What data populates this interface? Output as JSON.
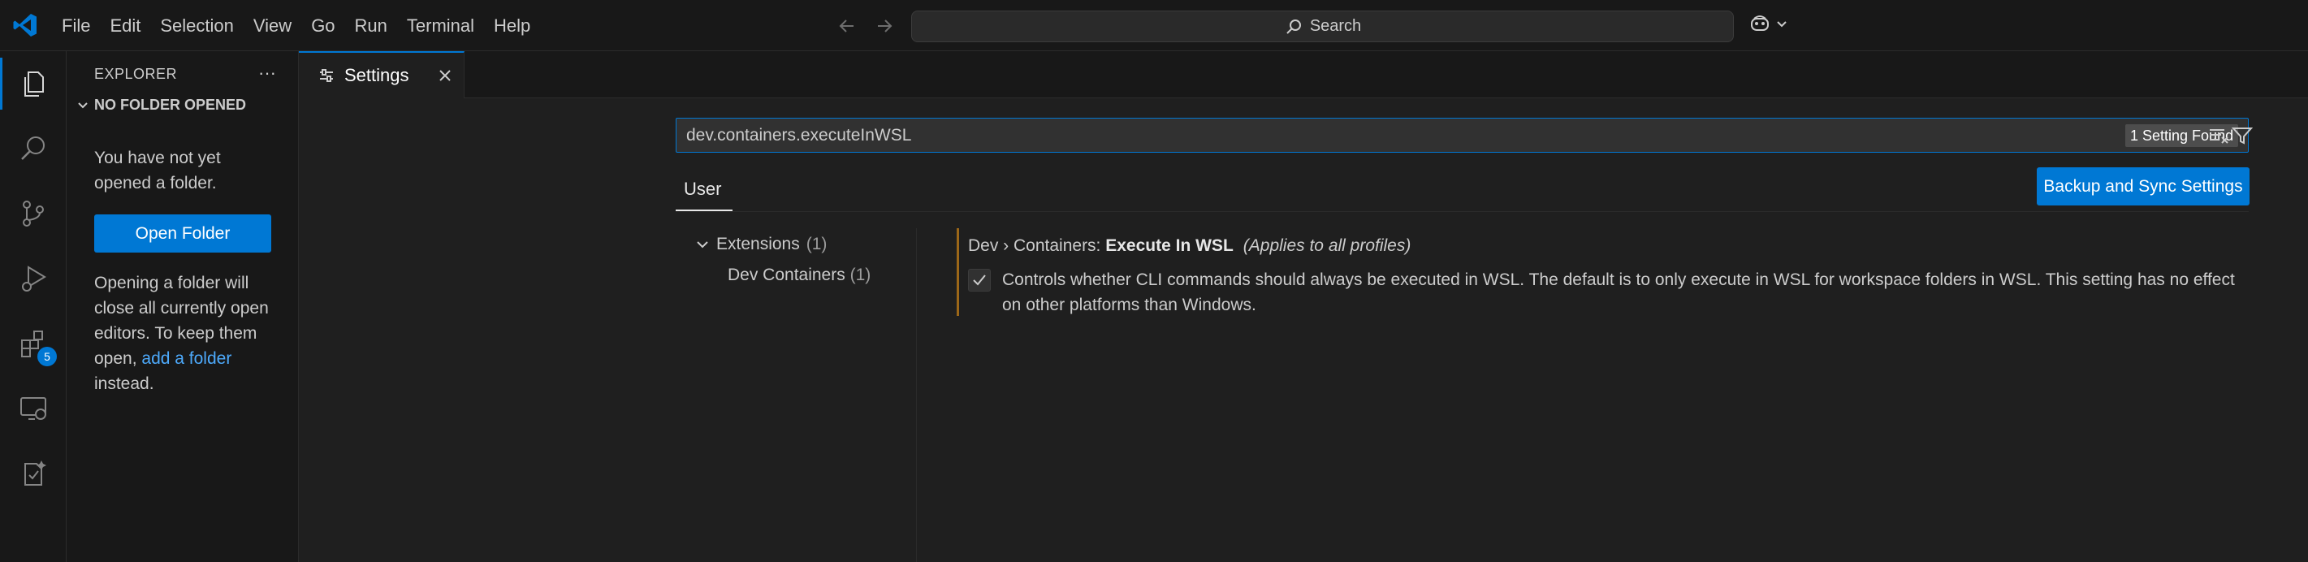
{
  "menu": [
    "File",
    "Edit",
    "Selection",
    "View",
    "Go",
    "Run",
    "Terminal",
    "Help"
  ],
  "command_center": {
    "placeholder": "Search"
  },
  "activity_bar": {
    "items": [
      "explorer-icon",
      "search-icon",
      "source-control-icon",
      "run-debug-icon",
      "extensions-icon",
      "remote-explorer-icon",
      "testing-icon"
    ],
    "extensions_badge": "5"
  },
  "sidebar": {
    "title": "EXPLORER",
    "more": "···",
    "section": "NO FOLDER OPENED",
    "text1": "You have not yet opened a folder.",
    "open_folder_label": "Open Folder",
    "text2_before": "Opening a folder will close all currently open editors. To keep them open, ",
    "text2_link": "add a folder",
    "text2_after": " instead."
  },
  "tab": {
    "label": "Settings"
  },
  "settings": {
    "search_value": "dev.containers.executeInWSL",
    "found_label": "1 Setting Found",
    "scope_tab": "User",
    "sync_button": "Backup and Sync Settings",
    "toc": {
      "extensions_label": "Extensions",
      "extensions_count": "(1)",
      "dev_containers_label": "Dev Containers",
      "dev_containers_count": "(1)"
    },
    "setting": {
      "category": "Dev › Containers: ",
      "name": "Execute In WSL",
      "applies": "(Applies to all profiles)",
      "checked": true,
      "description": "Controls whether CLI commands should always be executed in WSL. The default is to only execute in WSL for workspace folders in WSL. This setting has no effect on other platforms than Windows."
    }
  },
  "colors": {
    "accent": "#0078d4",
    "link": "#4daafc",
    "modified_bar": "#d18616"
  }
}
